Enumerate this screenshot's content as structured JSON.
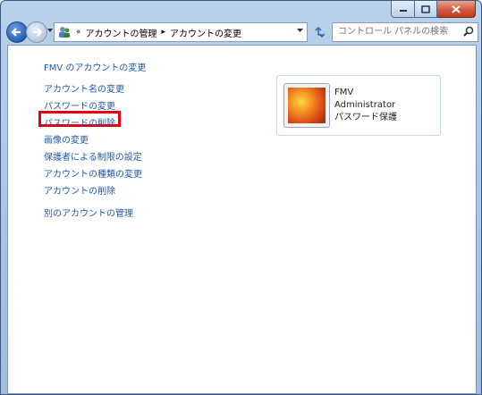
{
  "window": {
    "colors": {
      "accent": "#1e5aa8",
      "highlight": "#e8000f"
    }
  },
  "nav": {
    "breadcrumb_overflow": "«",
    "breadcrumb": [
      "アカウントの管理",
      "アカウントの変更"
    ],
    "breadcrumb_separator": "▸"
  },
  "search": {
    "placeholder": "コントロール パネルの検索"
  },
  "main": {
    "links": [
      "FMV のアカウントの変更",
      "アカウント名の変更",
      "パスワードの変更",
      "パスワードの削除",
      "画像の変更",
      "保護者による制限の設定",
      "アカウントの種類の変更",
      "アカウントの削除",
      "別のアカウントの管理"
    ],
    "highlighted_link": "パスワードの削除"
  },
  "account": {
    "name": "FMV",
    "type": "Administrator",
    "status": "パスワード保護",
    "picture_icon": "flower-picture"
  }
}
